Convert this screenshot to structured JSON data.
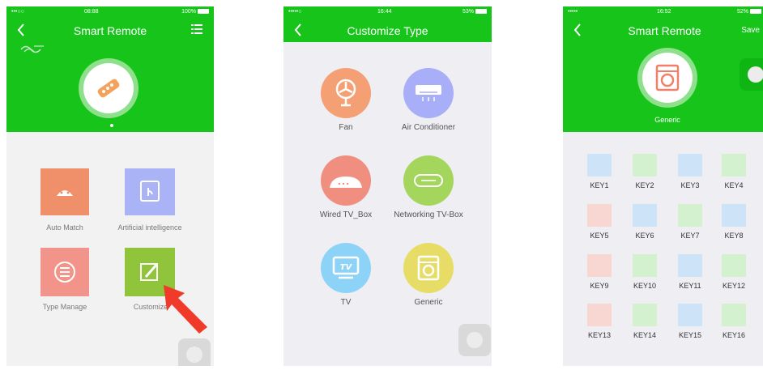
{
  "screen1": {
    "status": {
      "carrier": "•••○○",
      "time": "08:88",
      "battery": "100%"
    },
    "title": "Smart Remote",
    "tiles": [
      {
        "label": "Auto Match",
        "color": "#f0906a",
        "icon": "android-icon"
      },
      {
        "label": "Artificial intelligence",
        "color": "#a9b3f5",
        "icon": "touch-icon"
      },
      {
        "label": "Type Manage",
        "color": "#f2948a",
        "icon": "list-icon"
      },
      {
        "label": "Customize",
        "color": "#8fc43b",
        "icon": "edit-icon"
      }
    ],
    "arrow_color": "#f03a2a"
  },
  "screen2": {
    "status": {
      "carrier": "•••••○",
      "time": "16:44",
      "battery": "53%"
    },
    "title": "Customize Type",
    "types": [
      {
        "label": "Fan",
        "color": "#f4a074",
        "icon": "fan-icon"
      },
      {
        "label": "Air Conditioner",
        "color": "#a8aef7",
        "icon": "air-conditioner-icon"
      },
      {
        "label": "Wired TV_Box",
        "color": "#f08f7f",
        "icon": "tv-box-icon"
      },
      {
        "label": "Networking TV-Box",
        "color": "#a4d65d",
        "icon": "network-box-icon"
      },
      {
        "label": "TV",
        "color": "#8dd2f7",
        "icon": "tv-icon"
      },
      {
        "label": "Generic",
        "color": "#e7dd66",
        "icon": "washer-icon"
      }
    ]
  },
  "screen3": {
    "status": {
      "carrier": "•••••",
      "time": "16:52",
      "battery": "52%"
    },
    "title": "Smart Remote",
    "save_label": "Save",
    "device_label": "Generic",
    "keys": [
      {
        "label": "KEY1",
        "color": "#cde3f8"
      },
      {
        "label": "KEY2",
        "color": "#d3f0cf"
      },
      {
        "label": "KEY3",
        "color": "#cde3f8"
      },
      {
        "label": "KEY4",
        "color": "#d3f0cf"
      },
      {
        "label": "KEY5",
        "color": "#f8d7d2"
      },
      {
        "label": "KEY6",
        "color": "#cde3f8"
      },
      {
        "label": "KEY7",
        "color": "#d3f0cf"
      },
      {
        "label": "KEY8",
        "color": "#cde3f8"
      },
      {
        "label": "KEY9",
        "color": "#f8d7d2"
      },
      {
        "label": "KEY10",
        "color": "#d3f0cf"
      },
      {
        "label": "KEY11",
        "color": "#cde3f8"
      },
      {
        "label": "KEY12",
        "color": "#d3f0cf"
      },
      {
        "label": "KEY13",
        "color": "#f8d7d2"
      },
      {
        "label": "KEY14",
        "color": "#d3f0cf"
      },
      {
        "label": "KEY15",
        "color": "#cde3f8"
      },
      {
        "label": "KEY16",
        "color": "#d3f0cf"
      }
    ]
  }
}
